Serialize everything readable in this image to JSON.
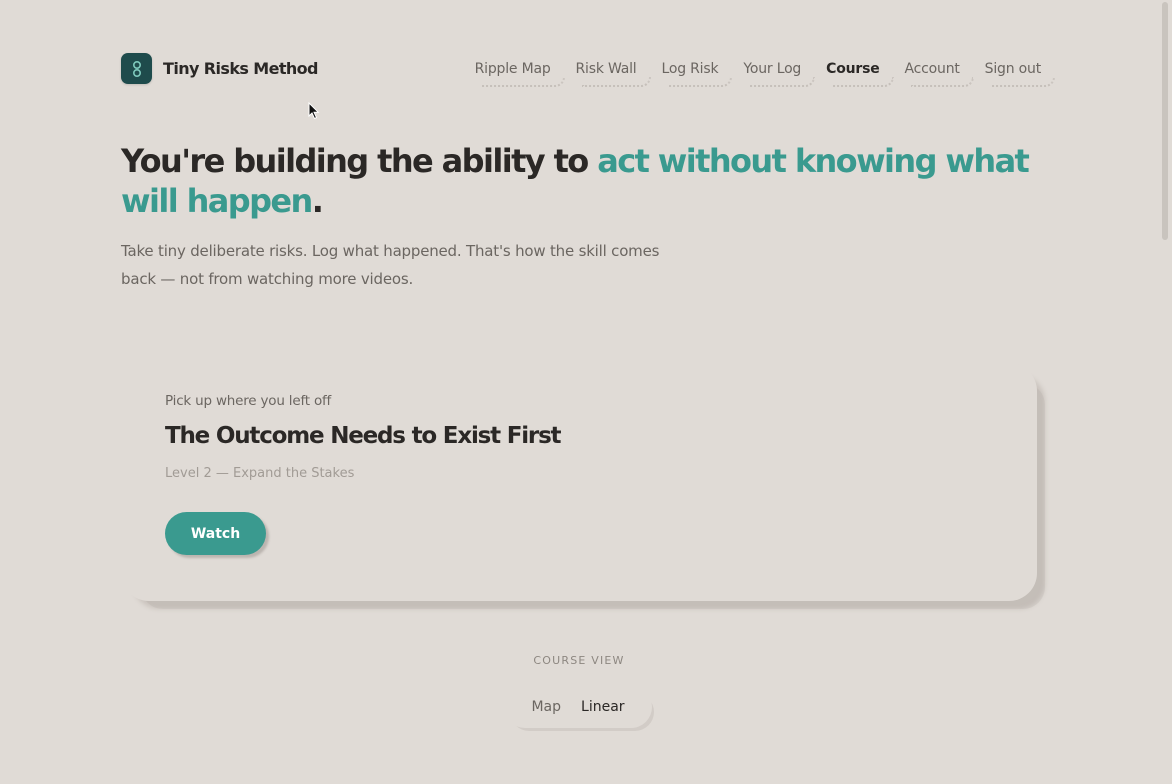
{
  "app": {
    "name": "Tiny Risks Method",
    "logo_icon": "infinity-icon",
    "accent_color": "#3a9a8f",
    "logo_color": "#1e4b4c"
  },
  "nav": {
    "items": [
      {
        "label": "Ripple Map",
        "active": false
      },
      {
        "label": "Risk Wall",
        "active": false
      },
      {
        "label": "Log Risk",
        "active": false
      },
      {
        "label": "Your Log",
        "active": false
      },
      {
        "label": "Course",
        "active": true
      },
      {
        "label": "Account",
        "active": false
      },
      {
        "label": "Sign out",
        "active": false
      }
    ]
  },
  "hero": {
    "title_prefix": "You're building the ability to ",
    "title_accent": "act without knowing what will happen",
    "title_suffix": ".",
    "subtitle": "Take tiny deliberate risks. Log what happened. That's how the skill comes back — not from watching more videos."
  },
  "resume_card": {
    "kicker": "Pick up where you left off",
    "title": "The Outcome Needs to Exist First",
    "meta": "Level 2 — Expand the Stakes",
    "button_label": "Watch"
  },
  "course_view": {
    "label": "COURSE VIEW",
    "options": [
      {
        "label": "Map",
        "active": false
      },
      {
        "label": "Linear",
        "active": true
      }
    ]
  }
}
